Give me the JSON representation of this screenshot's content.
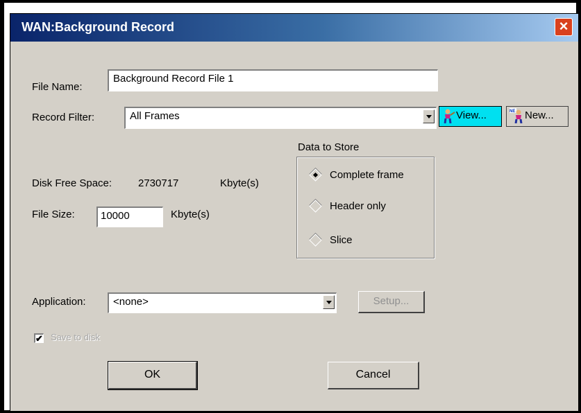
{
  "window": {
    "title": "WAN:Background Record",
    "close_icon": "close-icon"
  },
  "file_name": {
    "label": "File Name:",
    "value": "Background Record File 1"
  },
  "record_filter": {
    "label": "Record Filter:",
    "selected": "All Frames",
    "view_button": "View...",
    "new_button": "New..."
  },
  "data_to_store": {
    "title": "Data to Store",
    "options": [
      {
        "label": "Complete frame",
        "selected": true
      },
      {
        "label": "Header only",
        "selected": false
      },
      {
        "label": "Slice",
        "selected": false
      }
    ]
  },
  "disk_free_space": {
    "label": "Disk Free Space:",
    "value": "2730717",
    "unit": "Kbyte(s)"
  },
  "file_size": {
    "label": "File Size:",
    "value": "10000",
    "unit": "Kbyte(s)"
  },
  "application": {
    "label": "Application:",
    "selected": "<none>",
    "setup_button": "Setup..."
  },
  "save_to_disk": {
    "label": "Save to disk",
    "checked": true
  },
  "buttons": {
    "ok": "OK",
    "cancel": "Cancel"
  },
  "colors": {
    "title_start": "#0a246a",
    "title_end": "#a6caf0",
    "face": "#d4d0c8"
  }
}
